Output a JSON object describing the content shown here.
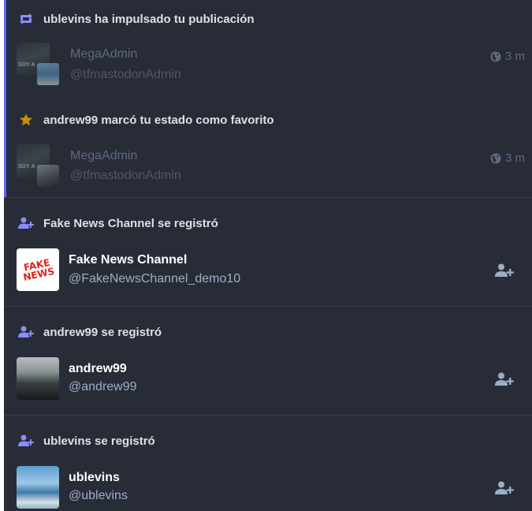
{
  "notifications": [
    {
      "type": "reblog",
      "message": "ublevins ha impulsado tu publicación",
      "status": {
        "display_name": "MegaAdmin",
        "handle": "@tfmastodonAdmin",
        "time": "3 m",
        "avatar_text": "SOY A"
      }
    },
    {
      "type": "favourite",
      "message": "andrew99 marcó tu estado como favorito",
      "status": {
        "display_name": "MegaAdmin",
        "handle": "@tfmastodonAdmin",
        "time": "3 m",
        "avatar_text": "SOY A"
      }
    },
    {
      "type": "follow_signup",
      "message": "Fake News Channel se registró",
      "account": {
        "display_name": "Fake News Channel",
        "handle": "@FakeNewsChannel_demo10",
        "avatar_text": "FAKE NEWS"
      }
    },
    {
      "type": "follow_signup",
      "message": "andrew99 se registró",
      "account": {
        "display_name": "andrew99",
        "handle": "@andrew99"
      }
    },
    {
      "type": "follow_signup",
      "message": "ublevins se registró",
      "account": {
        "display_name": "ublevins",
        "handle": "@ublevins"
      }
    }
  ],
  "icons": {
    "reblog": "retweet-icon",
    "favourite": "star-icon",
    "signup": "user-plus-icon",
    "visibility": "globe-icon",
    "follow": "follow-user-icon"
  },
  "colors": {
    "background": "#282c37",
    "accent": "#8c8dff",
    "favourite": "#ca8f04",
    "primary_text": "#ffffff",
    "secondary_text": "#9baec8"
  }
}
